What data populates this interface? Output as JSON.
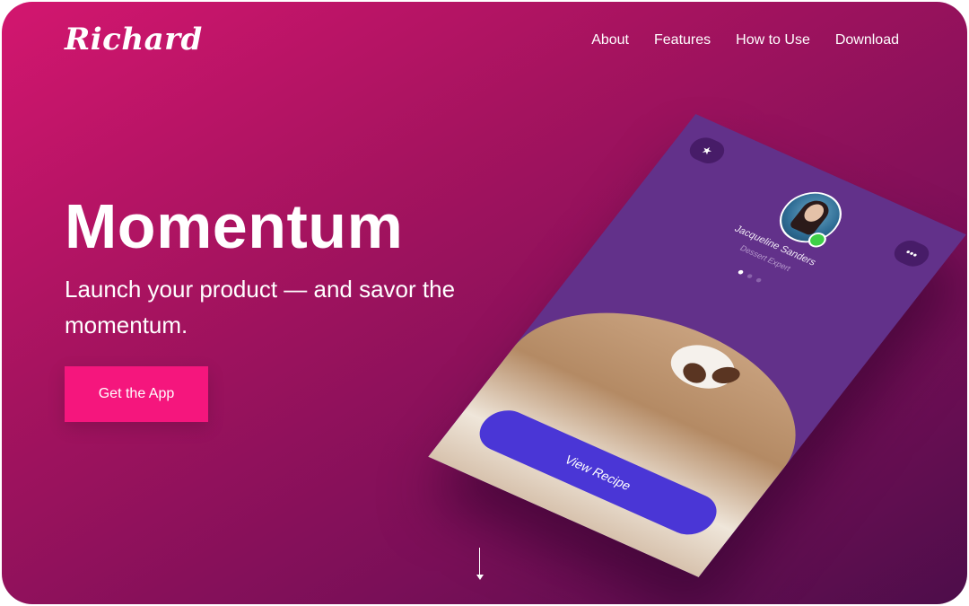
{
  "brand": {
    "logo_text": "Richard"
  },
  "nav": {
    "items": [
      {
        "label": "About"
      },
      {
        "label": "Features"
      },
      {
        "label": "How to Use"
      },
      {
        "label": "Download"
      }
    ]
  },
  "hero": {
    "title": "Momentum",
    "subtitle": "Launch your product — and savor the momentum.",
    "cta_label": "Get the App"
  },
  "phone": {
    "user_name": "Jacqueline Sanders",
    "user_role": "Dessert Expert",
    "left_button_icon": "star-icon",
    "right_button_icon": "ellipsis-icon",
    "left_button_glyph": "★",
    "right_button_glyph": "•••",
    "carousel_total": 3,
    "carousel_active": 1,
    "action_label": "View Recipe"
  },
  "colors": {
    "accent": "#f5167d",
    "gradient_start": "#d3166f",
    "gradient_end": "#4d0d4a",
    "phone_bg": "#62318a",
    "recipe_button": "#4a36d6",
    "online_status": "#3fcf47"
  }
}
